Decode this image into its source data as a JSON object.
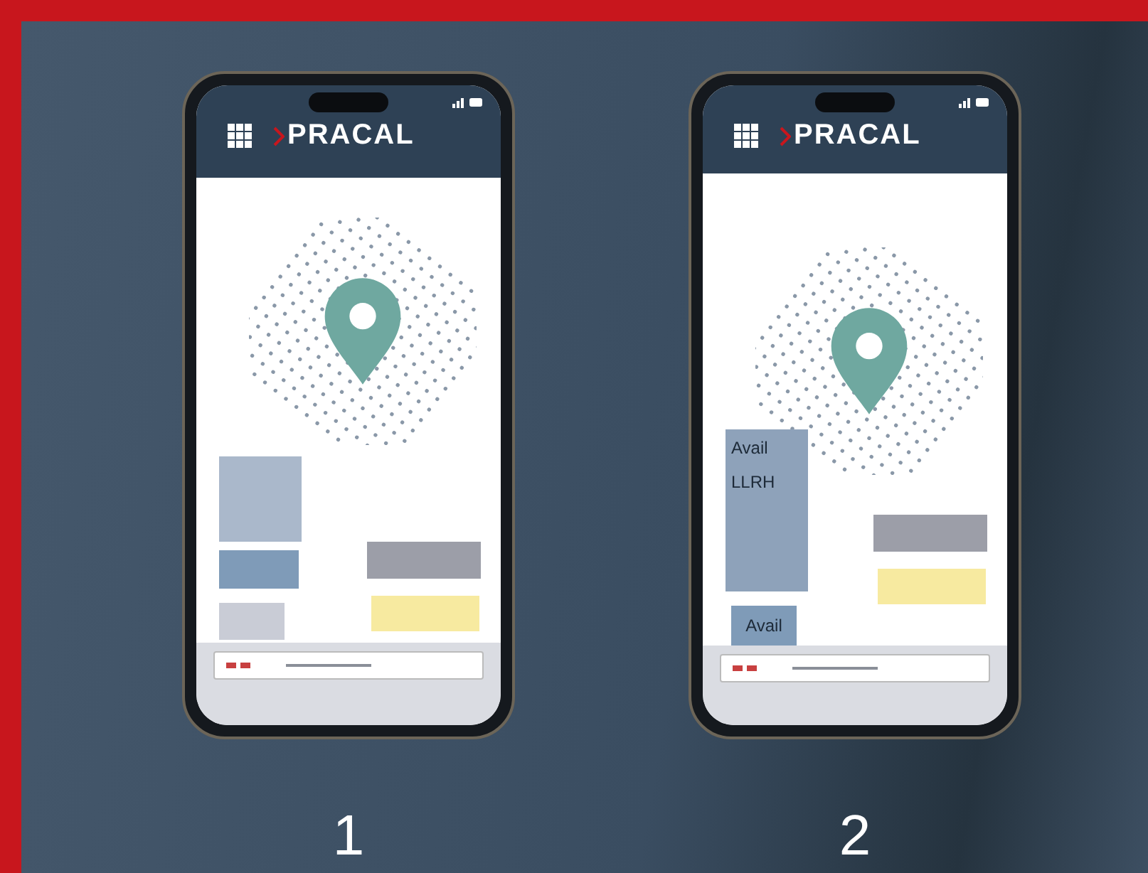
{
  "phones": [
    {
      "logo": "PRACAL",
      "caption": "1",
      "kind": "short"
    },
    {
      "logo": "PRACAL",
      "caption": "2",
      "kind": "tall",
      "panel_lines": [
        "Avail",
        "LLRH"
      ],
      "button_label": "Avail"
    }
  ]
}
